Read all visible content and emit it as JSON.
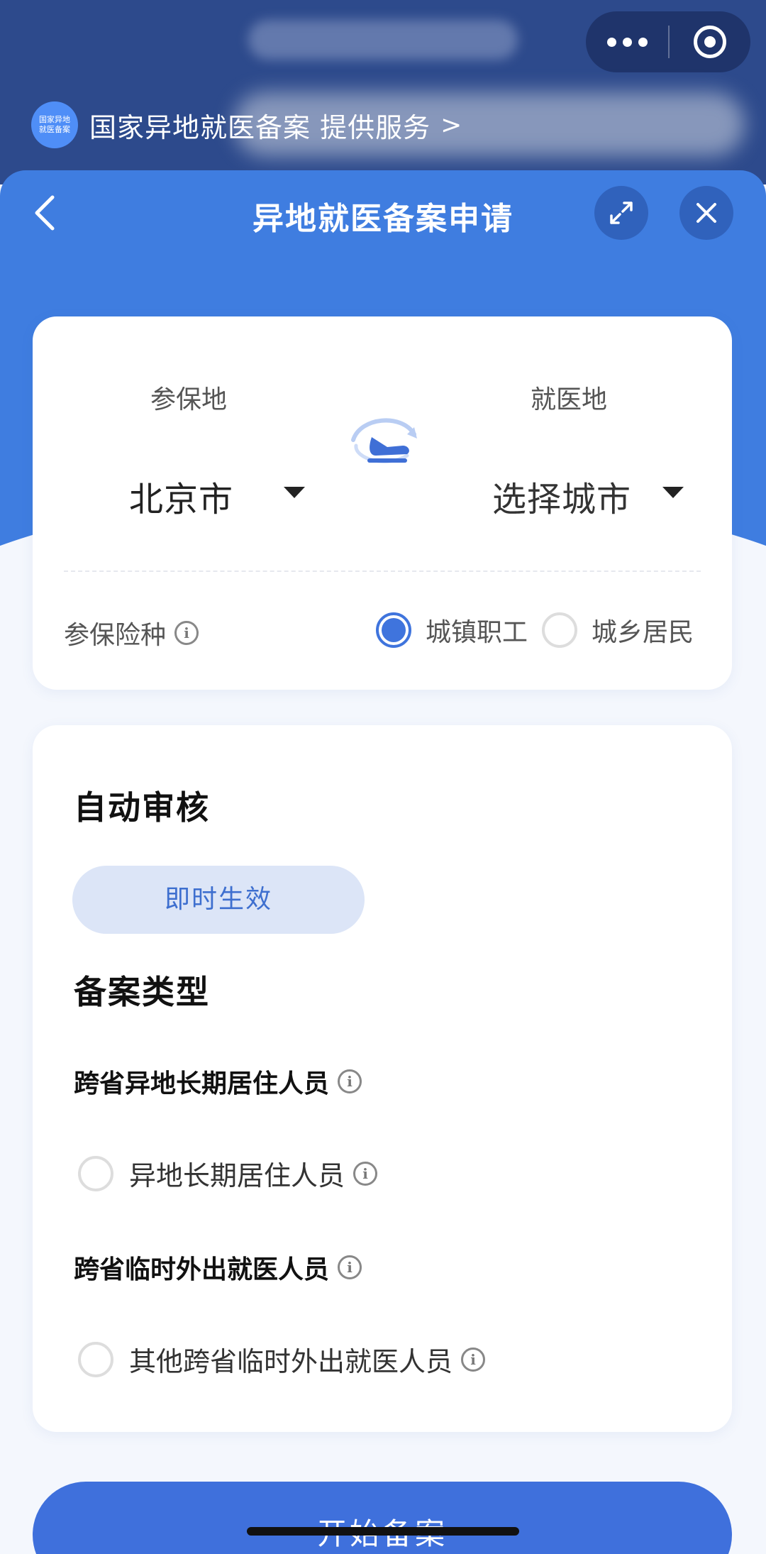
{
  "provider": {
    "logo_text": "国家异地就医备案",
    "label": "国家异地就医备案 提供服务",
    "chevron": ">"
  },
  "nav": {
    "title": "异地就医备案申请"
  },
  "location": {
    "insured_label": "参保地",
    "insured_city": "北京市",
    "treatment_label": "就医地",
    "treatment_city": "选择城市"
  },
  "insurance": {
    "label": "参保险种",
    "options": [
      "城镇职工",
      "城乡居民"
    ],
    "selected": "城镇职工"
  },
  "auto_review": {
    "title": "自动审核",
    "pill": "即时生效"
  },
  "filing_type": {
    "title": "备案类型",
    "groups": [
      {
        "title": "跨省异地长期居住人员",
        "option": "异地长期居住人员"
      },
      {
        "title": "跨省临时外出就医人员",
        "option": "其他跨省临时外出就医人员"
      }
    ]
  },
  "start_button": "开始备案",
  "colors": {
    "header_bg": "#2d4a8c",
    "primary": "#3f7de0",
    "button": "#3f70dc",
    "pill_bg": "#dce5f7"
  },
  "icons": [
    "more-icon",
    "target-icon",
    "back-icon",
    "expand-icon",
    "close-icon",
    "plane-swap-icon",
    "info-icon",
    "dropdown-icon"
  ]
}
